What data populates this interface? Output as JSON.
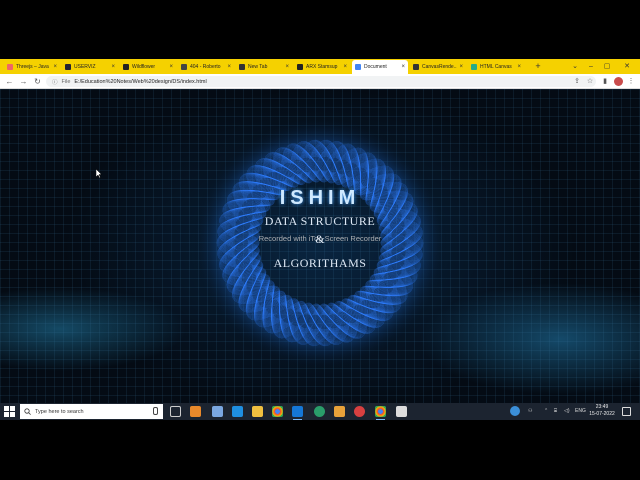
{
  "browser": {
    "tabs": [
      {
        "label": "Threejs – Java",
        "color": "#e66"
      },
      {
        "label": "USERVIZ",
        "color": "#223"
      },
      {
        "label": "Wildflower",
        "color": "#222"
      },
      {
        "label": "404 - Roberto",
        "color": "#444"
      },
      {
        "label": "New Tab",
        "color": "#333"
      },
      {
        "label": "ARX Stamsup",
        "color": "#222"
      },
      {
        "label": "Document",
        "color": "#4285f4"
      },
      {
        "label": "CanvasRende...",
        "color": "#333"
      },
      {
        "label": "HTML Canvas",
        "color": "#2a8"
      }
    ],
    "active_tab_index": 6,
    "new_tab_label": "+",
    "omnibox": {
      "scheme_label": "File",
      "url": "E:/Education%20Notes/Web%20design/DS/index.html"
    }
  },
  "page": {
    "title": "ISHIM",
    "line1": "DATA STRUCTURE",
    "ampersand": "&",
    "watermark": "Recorded with iTop Screen Recorder",
    "line2": "ALGORITHAMS",
    "accent_color": "#2f7fff"
  },
  "taskbar": {
    "search_placeholder": "Type here to search",
    "language": "ENG",
    "time": "23:49",
    "date": "15-07-2022"
  }
}
